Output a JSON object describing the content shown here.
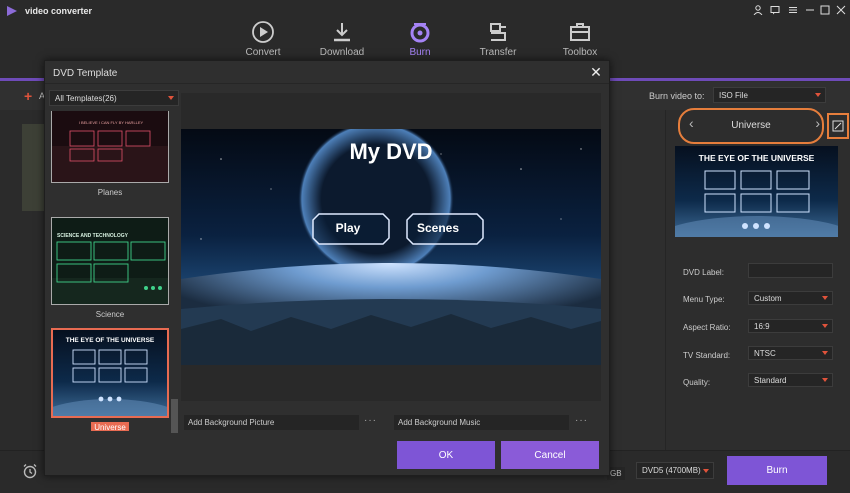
{
  "app": {
    "title": "video converter"
  },
  "toolbar": {
    "items": [
      {
        "label": "Convert"
      },
      {
        "label": "Download"
      },
      {
        "label": "Burn"
      },
      {
        "label": "Transfer"
      },
      {
        "label": "Toolbox"
      }
    ],
    "active": "Burn",
    "accent": "#a583f5"
  },
  "main": {
    "add_label": "A",
    "burn_to_label": "Burn video to:",
    "burn_to_value": "ISO File"
  },
  "right_panel": {
    "template_name": "Universe",
    "preview_title": "THE EYE OF THE UNIVERSE",
    "dvd_label": {
      "label": "DVD Label:",
      "value": ""
    },
    "menu_type": {
      "label": "Menu Type:",
      "value": "Custom"
    },
    "aspect_ratio": {
      "label": "Aspect Ratio:",
      "value": "16:9"
    },
    "tv_standard": {
      "label": "TV Standard:",
      "value": "NTSC"
    },
    "quality": {
      "label": "Quality:",
      "value": "Standard"
    }
  },
  "bottom": {
    "gb_text": "GB",
    "disc_value": "DVD5 (4700MB)",
    "burn_button": "Burn"
  },
  "modal": {
    "title": "DVD Template",
    "filter_value": "All Templates(26)",
    "templates": [
      {
        "name": "Planes",
        "thumb_title": "I BELIEVE I CAN FLY BY HARLLEY"
      },
      {
        "name": "Science",
        "thumb_title": "SCIENCE AND TECHNOLOGY"
      },
      {
        "name": "Universe",
        "thumb_title": "THE EYE OF THE UNIVERSE"
      }
    ],
    "selected_template": "Universe",
    "preview": {
      "title": "My DVD",
      "play_label": "Play",
      "scenes_label": "Scenes"
    },
    "bg_picture_placeholder": "Add Background Picture",
    "bg_music_placeholder": "Add Background Music",
    "ok_label": "OK",
    "cancel_label": "Cancel",
    "accent": "#7e55d6",
    "selection_color": "#e86b52"
  }
}
